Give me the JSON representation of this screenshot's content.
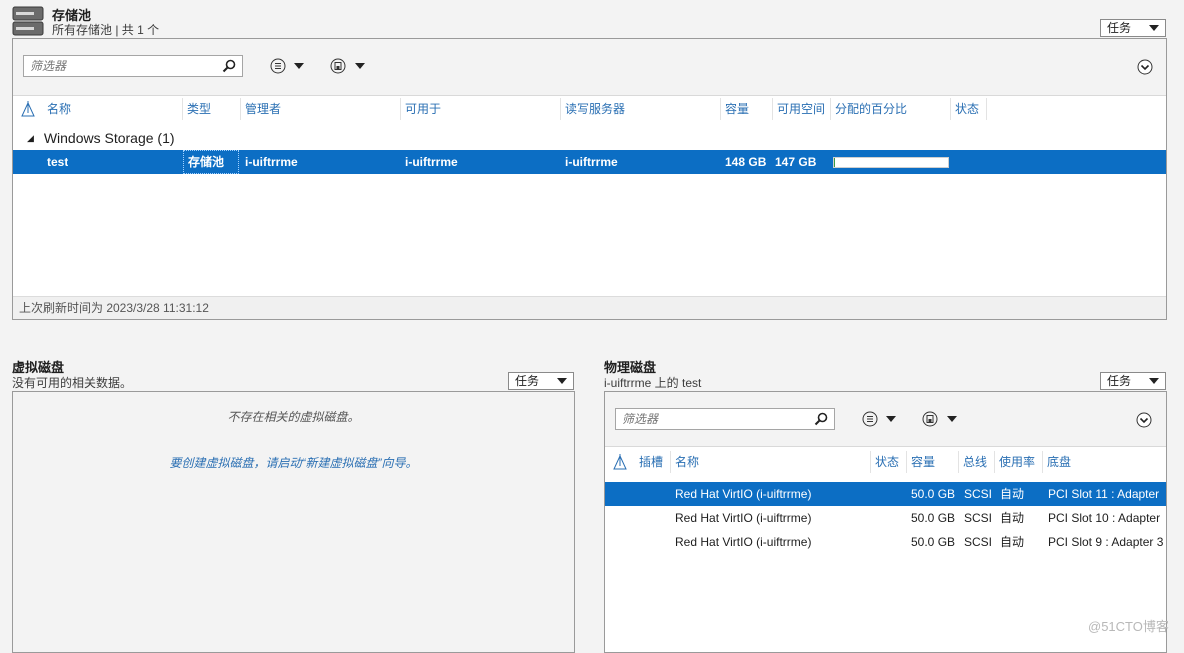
{
  "pool": {
    "title": "存储池",
    "subtitle": "所有存储池 | 共 1 个",
    "task_label": "任务",
    "filter_placeholder": "筛选器",
    "columns": [
      "名称",
      "类型",
      "管理者",
      "可用于",
      "读写服务器",
      "容量",
      "可用空间",
      "分配的百分比",
      "状态"
    ],
    "group_label": "Windows Storage (1)",
    "rows": [
      {
        "name": "test",
        "type": "存储池",
        "managed_by": "i-uiftrrme",
        "available_to": "i-uiftrrme",
        "rw_server": "i-uiftrrme",
        "capacity": "148 GB",
        "free": "147 GB",
        "allocated_fraction": 0.0067,
        "status": ""
      }
    ],
    "last_refresh": "上次刷新时间为 2023/3/28 11:31:12"
  },
  "virtual_disks": {
    "title": "虚拟磁盘",
    "subtitle": "没有可用的相关数据。",
    "task_label": "任务",
    "empty_message": "不存在相关的虚拟磁盘。",
    "hint_message": "要创建虚拟磁盘，请启动“新建虚拟磁盘”向导。"
  },
  "physical_disks": {
    "title": "物理磁盘",
    "subtitle": "i-uiftrrme 上的 test",
    "task_label": "任务",
    "filter_placeholder": "筛选器",
    "columns": [
      "插槽",
      "名称",
      "状态",
      "容量",
      "总线",
      "使用率",
      "底盘"
    ],
    "rows": [
      {
        "slot": "",
        "name": "Red Hat VirtIO (i-uiftrrme)",
        "status": "",
        "capacity": "50.0 GB",
        "bus": "SCSI",
        "usage": "自动",
        "chassis": "PCI Slot 11 : Adapter"
      },
      {
        "slot": "",
        "name": "Red Hat VirtIO (i-uiftrrme)",
        "status": "",
        "capacity": "50.0 GB",
        "bus": "SCSI",
        "usage": "自动",
        "chassis": "PCI Slot 10 : Adapter"
      },
      {
        "slot": "",
        "name": "Red Hat VirtIO (i-uiftrrme)",
        "status": "",
        "capacity": "50.0 GB",
        "bus": "SCSI",
        "usage": "自动",
        "chassis": "PCI Slot 9 : Adapter 3"
      }
    ]
  },
  "watermark": "@51CTO博客",
  "colors": {
    "selection": "#0c6ec4",
    "header_text": "#2a6fb3",
    "progress_fill": "#3a9b45"
  }
}
